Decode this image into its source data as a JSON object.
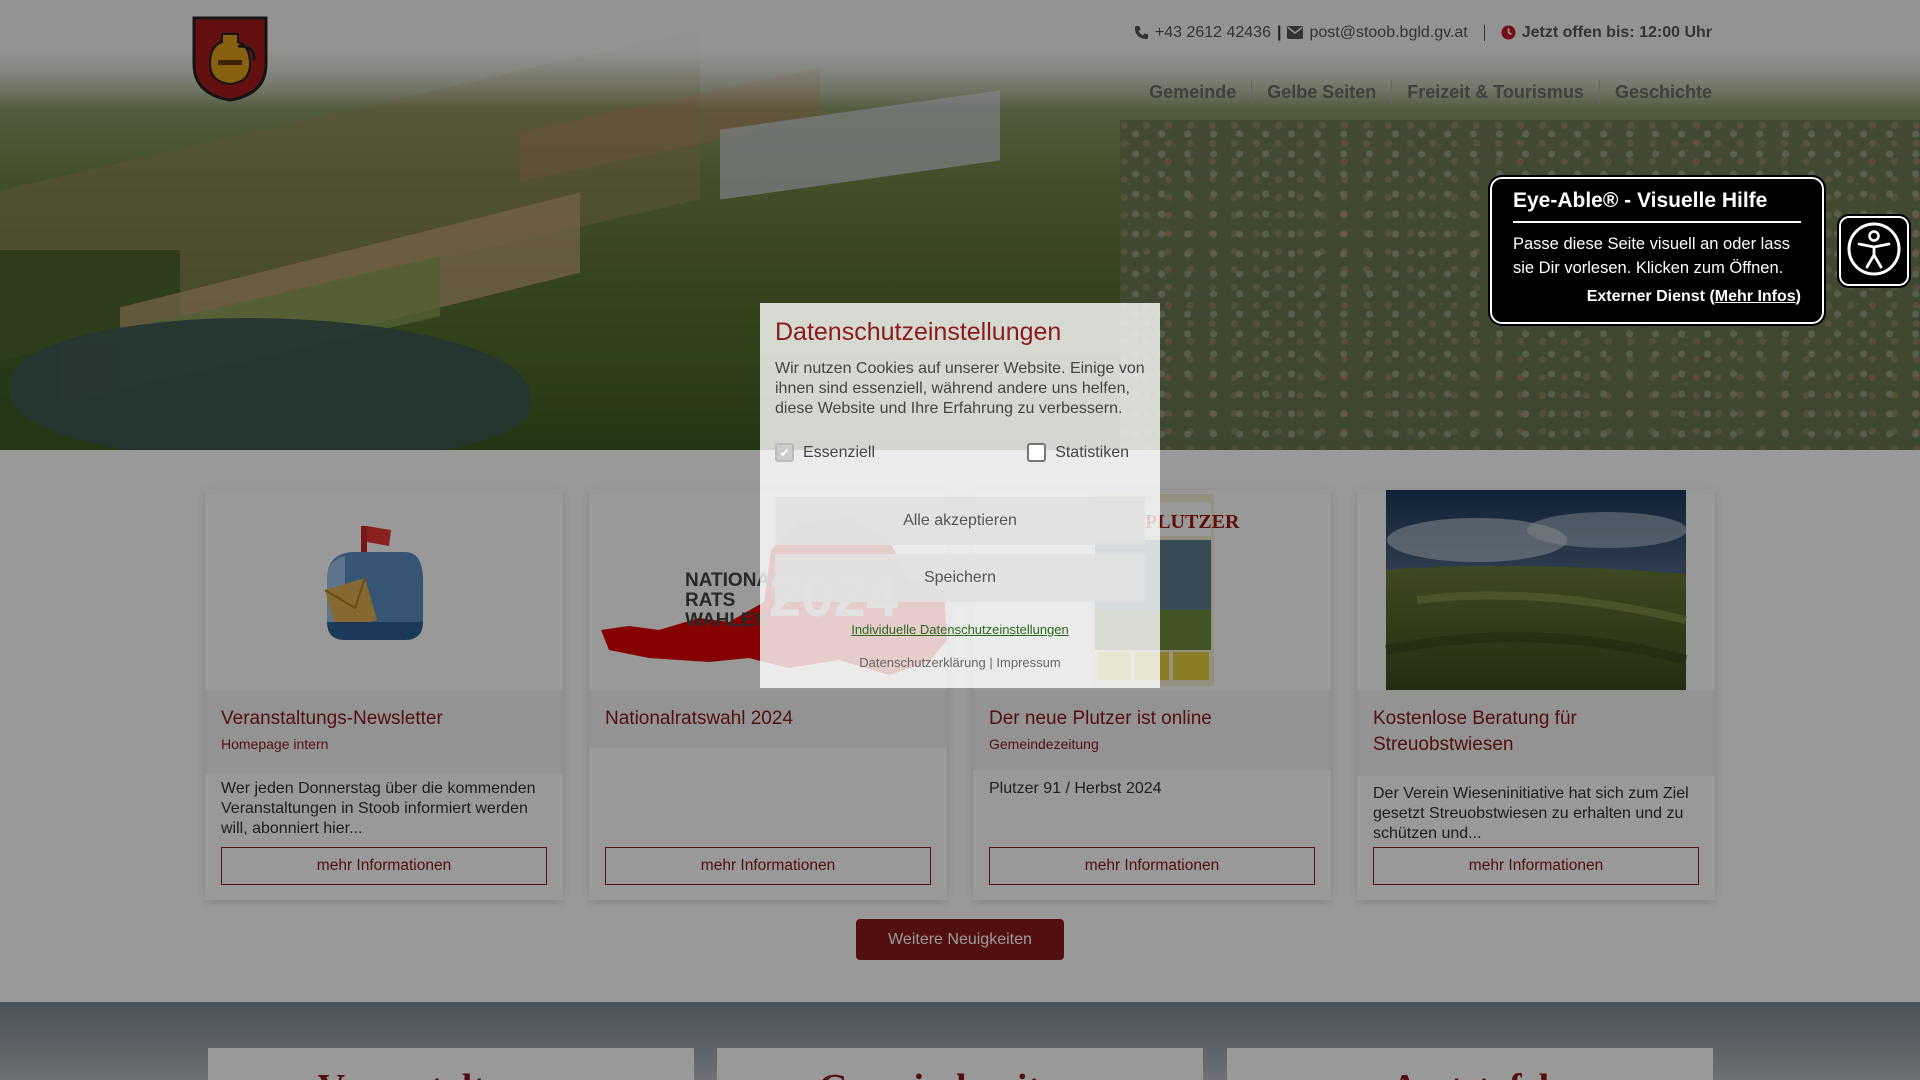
{
  "header": {
    "phone": "+43 2612 42436",
    "separator": "|",
    "email": "post@stoob.bgld.gv.at",
    "open_hours": "Jetzt offen bis: 12:00 Uhr"
  },
  "nav": {
    "items": [
      {
        "label": "Gemeinde"
      },
      {
        "label": "Gelbe Seiten"
      },
      {
        "label": "Freizeit & Tourismus"
      },
      {
        "label": "Geschichte"
      }
    ]
  },
  "eye_able": {
    "title": "Eye-Able® - Visuelle Hilfe",
    "text": "Passe diese Seite visuell an oder lass sie Dir vorlesen. Klicken zum Öffnen.",
    "external_prefix": "Externer Dienst (",
    "external_link": "Mehr Infos",
    "external_suffix": ")"
  },
  "cards": [
    {
      "title": "Veranstaltungs-Newsletter",
      "subtitle": "Homepage intern",
      "text": "Wer jeden Donnerstag über die kommenden Veranstaltungen in Stoob informiert werden will, abonniert hier...",
      "button": "mehr Informationen"
    },
    {
      "title": "Nationalratswahl 2024",
      "subtitle": "",
      "text": "",
      "button": "mehr Informationen",
      "image_text_line1": "NATIONAL",
      "image_text_line2": "RATS",
      "image_text_line3": "WAHLEN",
      "image_year": "2024"
    },
    {
      "title": "Der neue Plutzer ist online",
      "subtitle": "Gemeindezeitung",
      "text": "Plutzer 91 / Herbst 2024",
      "button": "mehr Informationen",
      "image_text": "PLUTZER"
    },
    {
      "title": "Kostenlose Beratung für Streuobstwiesen",
      "subtitle": "",
      "text": "Der Verein Wieseninitiative hat sich zum Ziel gesetzt Streuobstwiesen zu erhalten und zu schützen und...",
      "button": "mehr Informationen"
    }
  ],
  "more_news_button": "Weitere Neuigkeiten",
  "bottom_boxes": [
    "Veranstaltungen",
    "Gemeindezeitung",
    "Amtstafel"
  ],
  "cookie_modal": {
    "title": "Datenschutzeinstellungen",
    "text": "Wir nutzen Cookies auf unserer Website. Einige von ihnen sind essenziell, während andere uns helfen, diese Website und Ihre Erfahrung zu verbessern.",
    "checkbox_essential": "Essenziell",
    "checkbox_statistics": "Statistiken",
    "essential_checked": true,
    "statistics_checked": false,
    "accept_all": "Alle akzeptieren",
    "save": "Speichern",
    "individual_link": "Individuelle Datenschutzeinstellungen",
    "privacy_link": "Datenschutzerklärung",
    "footer_sep": "|",
    "imprint_link": "Impressum"
  },
  "colors": {
    "brand": "#8b1a1a",
    "overlay": "rgba(0,0,0,0.4)",
    "link_green": "#2a6a1e"
  }
}
